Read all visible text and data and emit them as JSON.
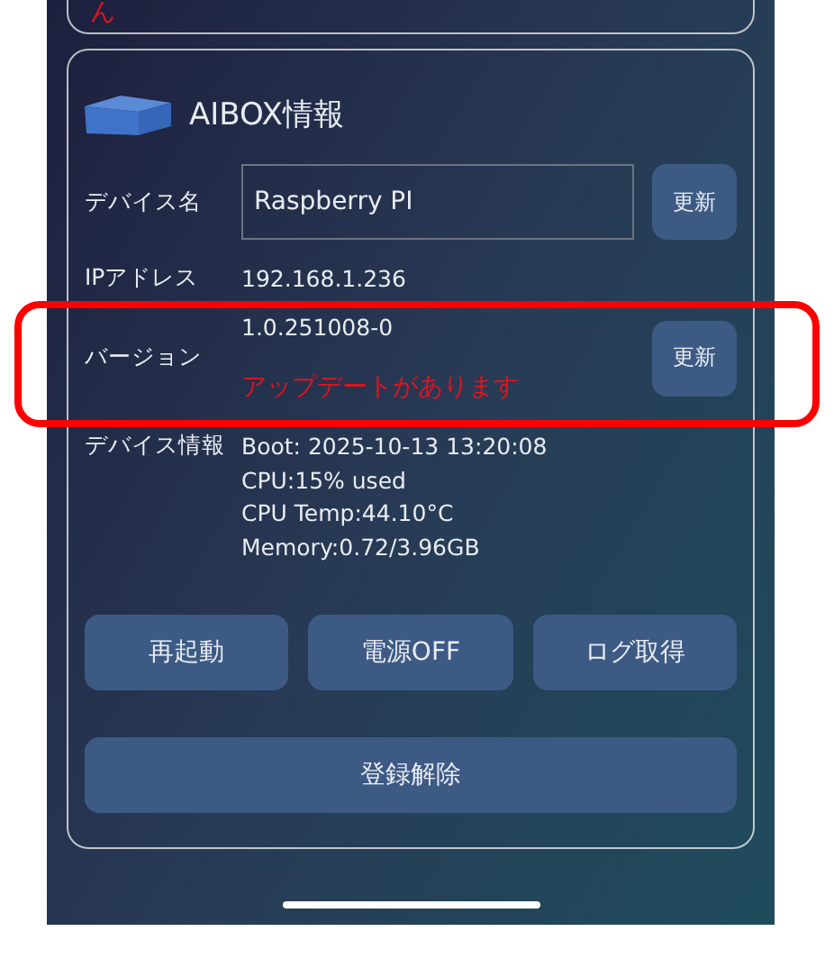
{
  "top_card": {
    "text": "ん"
  },
  "aibox": {
    "title": "AIBOX情報",
    "device_name": {
      "label": "デバイス名",
      "value": "Raspberry PI",
      "button": "更新"
    },
    "ip": {
      "label": "IPアドレス",
      "value": "192.168.1.236"
    },
    "version": {
      "label": "バージョン",
      "value": "1.0.251008-0",
      "notice": "アップデートがあります",
      "button": "更新",
      "highlighted": true
    },
    "device_info": {
      "label": "デバイス情報",
      "lines": [
        "Boot: 2025-10-13 13:20:08",
        "CPU:15% used",
        "CPU Temp:44.10°C",
        "Memory:0.72/3.96GB"
      ]
    },
    "actions": [
      "再起動",
      "電源OFF",
      "ログ取得"
    ],
    "unregister": "登録解除"
  }
}
